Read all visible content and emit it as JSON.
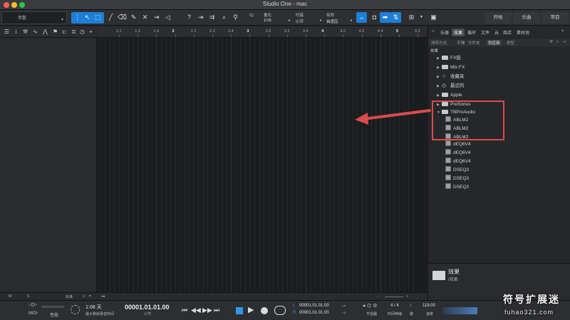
{
  "window": {
    "title": "Studio One - mac"
  },
  "toolbar": {
    "params_label": "参数",
    "quantize_label": "量化",
    "quantize_value": "1/16",
    "timebase_label": "时基",
    "timebase_value": "小节",
    "snap_label": "吸附",
    "snap_value": "自适应",
    "iq_label": "IQ",
    "start_button": "开始",
    "song_button": "乐曲",
    "project_button": "项目"
  },
  "ruler": {
    "marks": [
      "1.2",
      "1.3",
      "1.4",
      "2",
      "2.2",
      "2.3",
      "2.4",
      "3",
      "3.2",
      "3.3",
      "3.4",
      "4",
      "4.2",
      "4.3",
      "4.4",
      "5",
      "5.2"
    ]
  },
  "browser": {
    "tabs": [
      "乐器",
      "效果",
      "循环",
      "文件",
      "云",
      "商店",
      "素材池"
    ],
    "active_tab": "效果",
    "sort_label": "排序方式:",
    "sort_options": [
      "平铺",
      "文件夹",
      "供应商",
      "类型"
    ],
    "active_sort": "供应商",
    "path": "效果",
    "items": [
      {
        "label": "FX链",
        "kind": "folder",
        "expanded": false
      },
      {
        "label": "Mix FX",
        "kind": "folder",
        "expanded": false
      },
      {
        "label": "收藏夹",
        "kind": "star",
        "expanded": false
      },
      {
        "label": "最近的",
        "kind": "clock",
        "expanded": false
      },
      {
        "label": "Apple",
        "kind": "folder",
        "expanded": false
      },
      {
        "label": "PreSonus",
        "kind": "folder",
        "expanded": false
      },
      {
        "label": "TBProAudio",
        "kind": "folder",
        "expanded": true
      },
      {
        "label": "ABLM2",
        "kind": "plugin"
      },
      {
        "label": "ABLM2",
        "kind": "plugin"
      },
      {
        "label": "ABLM2",
        "kind": "plugin"
      },
      {
        "label": "dEQ6V4",
        "kind": "plugin"
      },
      {
        "label": "dEQ6V4",
        "kind": "plugin"
      },
      {
        "label": "dEQ6V4",
        "kind": "plugin"
      },
      {
        "label": "DSEQ3",
        "kind": "plugin"
      },
      {
        "label": "DSEQ3",
        "kind": "plugin"
      },
      {
        "label": "DSEQ3",
        "kind": "plugin"
      }
    ],
    "footer_title": "效果",
    "footer_subtitle": "/效果"
  },
  "bottom_strip": {
    "m_label": "M",
    "s_label": "S",
    "std_label": "标准"
  },
  "transport": {
    "midi_label": "MIDI",
    "perf_label": "性能",
    "time_days": "1:06 天",
    "time_days_sub": "最大剩余录音时间",
    "position": "00001.01.01.00",
    "position_sub": "小节",
    "loop_l": "00001.01.01.00",
    "loop_r": "00001.01.01.00",
    "l_label": "L",
    "r_label": "R",
    "metronome_label": "节拍器",
    "signature": "4 / 4",
    "signature_sub": "拍号",
    "time_sig_sub": "时间伸缩",
    "key_sub": "键",
    "tempo": "119.00",
    "tempo_sub": "速度"
  },
  "watermark": {
    "line1": "符号扩展迷",
    "line2": "fuhao321.com"
  },
  "colors": {
    "accent": "#1d7fd6",
    "callout": "#d94b4b"
  }
}
